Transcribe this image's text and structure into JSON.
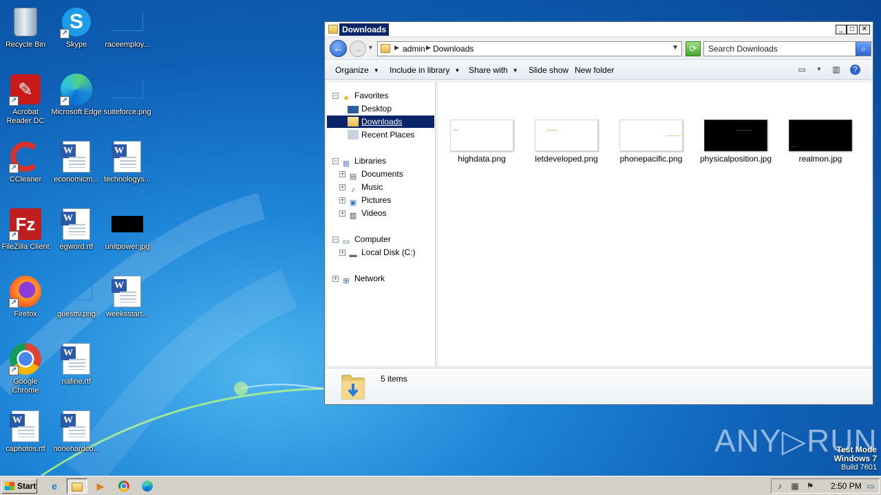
{
  "desktop": {
    "icons": [
      {
        "label": "Recycle Bin"
      },
      {
        "label": "Skype"
      },
      {
        "label": "raceemploy..."
      },
      {
        "label": "Acrobat Reader DC"
      },
      {
        "label": "Microsoft Edge"
      },
      {
        "label": "suiteforce.png"
      },
      {
        "label": "CCleaner"
      },
      {
        "label": "economicm..."
      },
      {
        "label": "technologys..."
      },
      {
        "label": "FileZilla Client"
      },
      {
        "label": "egword.rtf"
      },
      {
        "label": "unitpower.jpg"
      },
      {
        "label": "Firefox"
      },
      {
        "label": "guesttv.png"
      },
      {
        "label": "weeksstart..."
      },
      {
        "label": "Google Chrome"
      },
      {
        "label": "nafine.rtf"
      },
      {
        "label": "caphotos.rtf"
      },
      {
        "label": "nonehardco..."
      }
    ]
  },
  "explorer": {
    "title": "Downloads",
    "address": {
      "crumbs": [
        "admin",
        "Downloads"
      ]
    },
    "search": {
      "placeholder": "Search Downloads"
    },
    "commands": {
      "organize": "Organize",
      "include_in_library": "Include in library",
      "share_with": "Share with",
      "slide_show": "Slide show",
      "new_folder": "New folder"
    },
    "nav": {
      "favorites": "Favorites",
      "desktop": "Desktop",
      "downloads": "Downloads",
      "recent_places": "Recent Places",
      "libraries": "Libraries",
      "documents": "Documents",
      "music": "Music",
      "pictures": "Pictures",
      "videos": "Videos",
      "computer": "Computer",
      "local_disk": "Local Disk (C:)",
      "network": "Network"
    },
    "files": [
      {
        "name": "highdata.png"
      },
      {
        "name": "letdeveloped.png"
      },
      {
        "name": "phonepacific.png"
      },
      {
        "name": "physicalposition.jpg"
      },
      {
        "name": "realmon.jpg"
      }
    ],
    "details": {
      "count": "5 items"
    }
  },
  "watermark": {
    "text": "ANY▷RUN"
  },
  "system": {
    "test_mode": "Test Mode",
    "os": "Windows 7",
    "build": "Build 7601"
  },
  "taskbar": {
    "start": "Start",
    "clock": "2:50 PM"
  }
}
